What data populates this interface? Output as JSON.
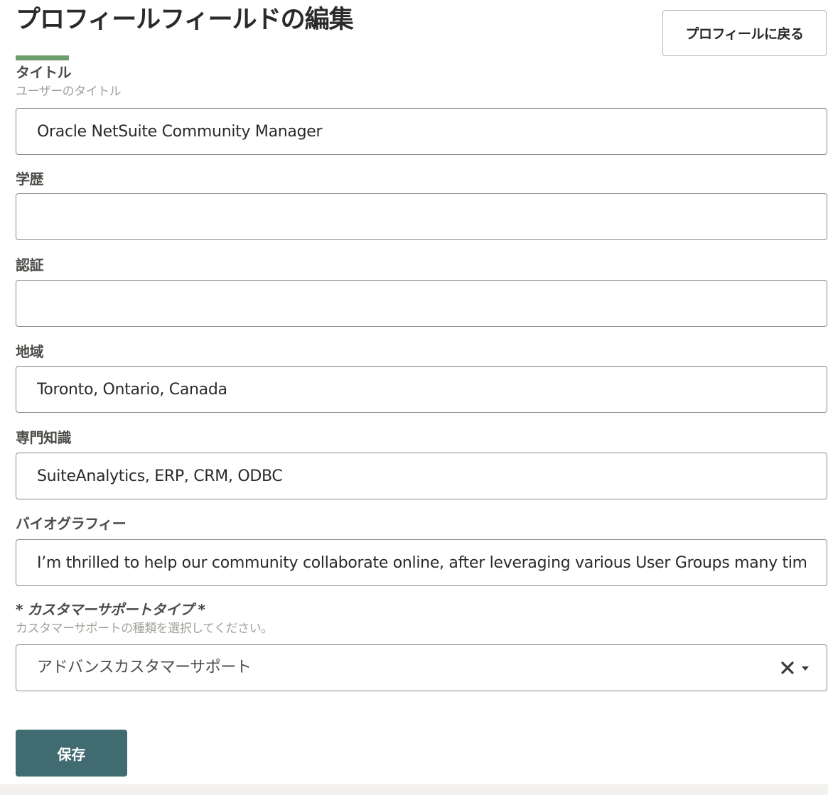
{
  "header": {
    "title": "プロフィールフィールドの編集",
    "back_button_label": "プロフィールに戻る",
    "accent_color": "#6d9d6f"
  },
  "fields": {
    "title": {
      "label": "タイトル",
      "help": "ユーザーのタイトル",
      "value": "Oracle NetSuite Community Manager"
    },
    "education": {
      "label": "学歴",
      "value": ""
    },
    "certification": {
      "label": "認証",
      "value": ""
    },
    "region": {
      "label": "地域",
      "value": "Toronto, Ontario, Canada"
    },
    "expertise": {
      "label": "専門知識",
      "value": "SuiteAnalytics, ERP, CRM, ODBC"
    },
    "biography": {
      "label": "バイオグラフィー",
      "value": "I’m thrilled to help our community collaborate online, after leveraging various User Groups many tim"
    },
    "support_type": {
      "label": "* カスタマーサポートタイプ *",
      "help": "カスタマーサポートの種類を選択してください。",
      "selected": "アドバンスカスタマーサポート",
      "clear_icon": "close-icon",
      "dropdown_icon": "chevron-down-icon"
    }
  },
  "actions": {
    "save_label": "保存",
    "save_color": "#406b70"
  }
}
